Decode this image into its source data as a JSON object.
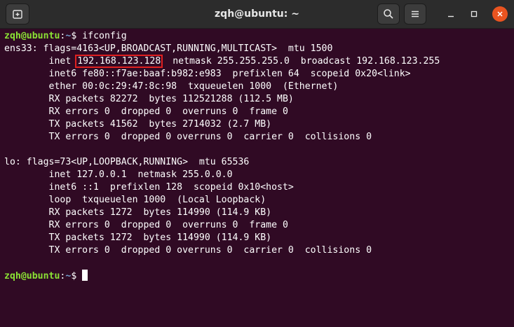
{
  "window": {
    "title": "zqh@ubuntu: ~"
  },
  "icons": {
    "new_tab": "new-tab-icon",
    "search": "search-icon",
    "menu": "hamburger-menu-icon",
    "minimize": "minimize-icon",
    "maximize": "maximize-icon",
    "close": "close-icon"
  },
  "colors": {
    "terminal_bg": "#300a24",
    "prompt_user": "#8ae234",
    "prompt_path": "#729fcf",
    "highlight_box": "#e02020",
    "close_button": "#e95420"
  },
  "prompt": {
    "user": "zqh@ubuntu",
    "sep": ":",
    "path": "~",
    "symbol": "$ "
  },
  "terminal": {
    "command": "ifconfig",
    "ens33": {
      "flags": "ens33: flags=4163<UP,BROADCAST,RUNNING,MULTICAST>  mtu 1500",
      "inet_label": "        inet ",
      "inet_ip": "192.168.123.128",
      "inet_rest": "  netmask 255.255.255.0  broadcast 192.168.123.255",
      "inet6": "        inet6 fe80::f7ae:baaf:b982:e983  prefixlen 64  scopeid 0x20<link>",
      "ether": "        ether 00:0c:29:47:8c:98  txqueuelen 1000  (Ethernet)",
      "rx_packets": "        RX packets 82272  bytes 112521288 (112.5 MB)",
      "rx_errors": "        RX errors 0  dropped 0  overruns 0  frame 0",
      "tx_packets": "        TX packets 41562  bytes 2714032 (2.7 MB)",
      "tx_errors": "        TX errors 0  dropped 0 overruns 0  carrier 0  collisions 0"
    },
    "lo": {
      "flags": "lo: flags=73<UP,LOOPBACK,RUNNING>  mtu 65536",
      "inet": "        inet 127.0.0.1  netmask 255.0.0.0",
      "inet6": "        inet6 ::1  prefixlen 128  scopeid 0x10<host>",
      "loop": "        loop  txqueuelen 1000  (Local Loopback)",
      "rx_packets": "        RX packets 1272  bytes 114990 (114.9 KB)",
      "rx_errors": "        RX errors 0  dropped 0  overruns 0  frame 0",
      "tx_packets": "        TX packets 1272  bytes 114990 (114.9 KB)",
      "tx_errors": "        TX errors 0  dropped 0 overruns 0  carrier 0  collisions 0"
    }
  }
}
